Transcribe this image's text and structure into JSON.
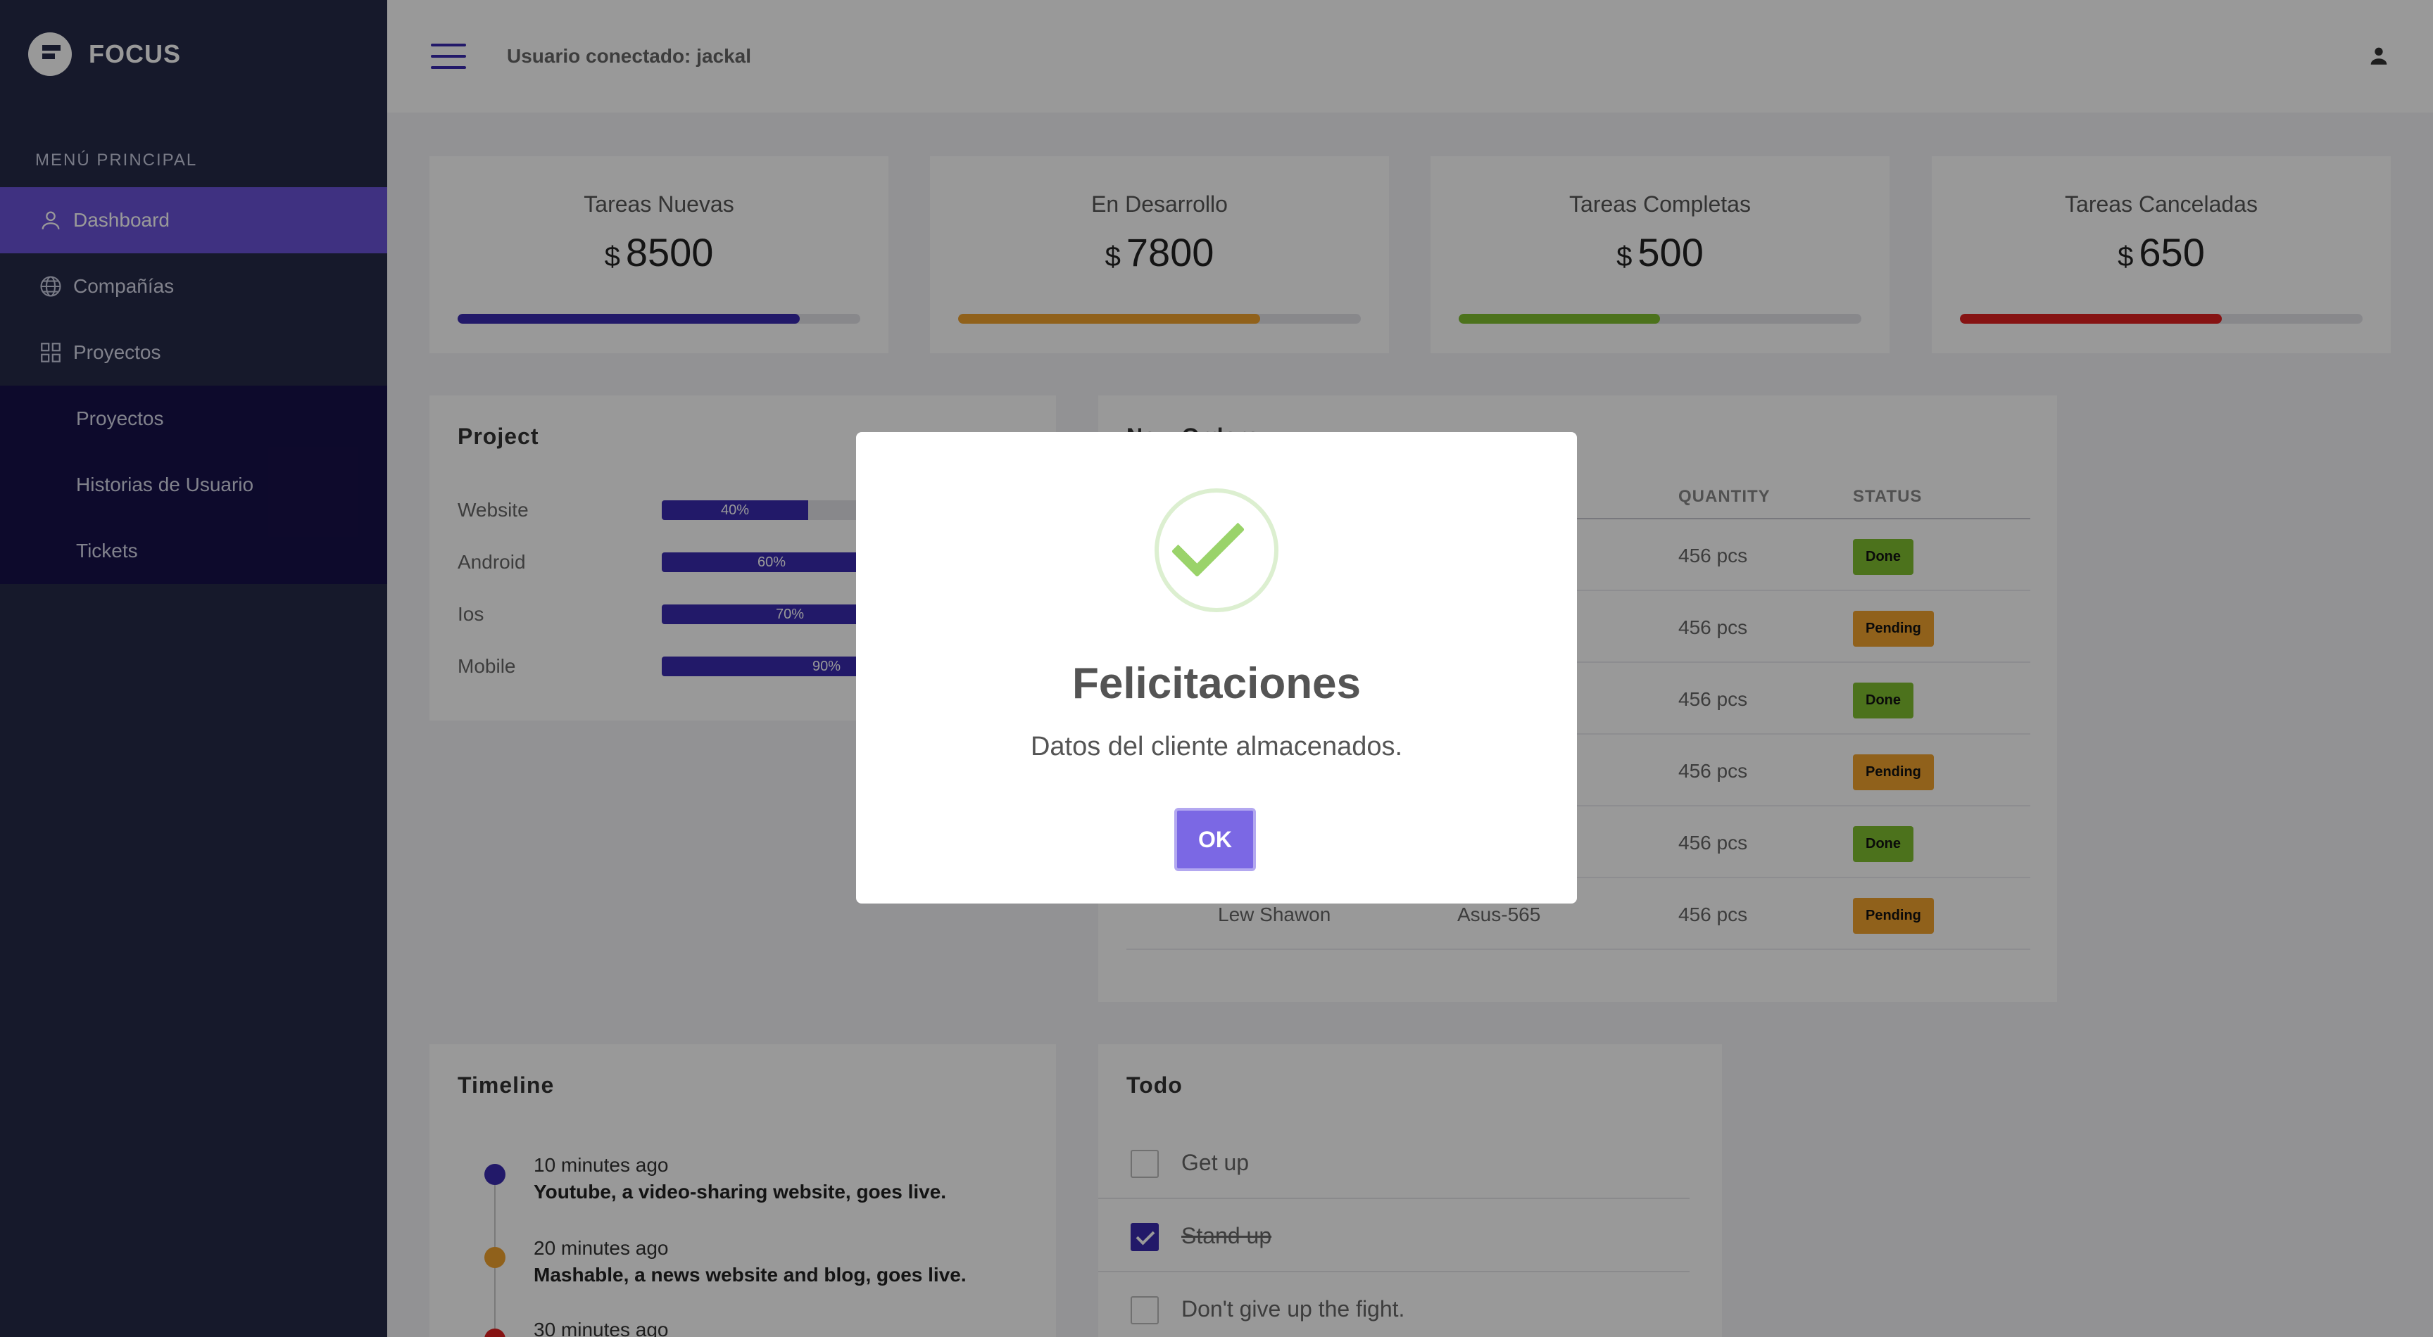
{
  "brand": {
    "name": "FOCUS"
  },
  "sidebar": {
    "menu_title": "MENÚ PRINCIPAL",
    "items": [
      {
        "label": "Dashboard",
        "icon": "user-icon",
        "active": true
      },
      {
        "label": "Compañías",
        "icon": "globe-icon"
      },
      {
        "label": "Proyectos",
        "icon": "grid-icon"
      }
    ],
    "subitems": [
      {
        "label": "Proyectos"
      },
      {
        "label": "Historias de Usuario"
      },
      {
        "label": "Tickets"
      }
    ]
  },
  "topbar": {
    "user_text": "Usuario conectado: jackal",
    "menu_icon": "hamburger-icon",
    "profile_icon": "person-icon"
  },
  "stats": [
    {
      "label": "Tareas Nuevas",
      "currency": "$",
      "value": "8500",
      "progress": 0.85,
      "color": "#3a2bb0"
    },
    {
      "label": "En Desarrollo",
      "currency": "$",
      "value": "7800",
      "progress": 0.75,
      "color": "#f0a22e"
    },
    {
      "label": "Tareas Completas",
      "currency": "$",
      "value": "500",
      "progress": 0.5,
      "color": "#7fbf2f"
    },
    {
      "label": "Tareas Canceladas",
      "currency": "$",
      "value": "650",
      "progress": 0.65,
      "color": "#e02020"
    }
  ],
  "project": {
    "title": "Project",
    "rows": [
      {
        "label": "Website",
        "percent": "40%",
        "value": 0.4
      },
      {
        "label": "Android",
        "percent": "60%",
        "value": 0.6
      },
      {
        "label": "Ios",
        "percent": "70%",
        "value": 0.7
      },
      {
        "label": "Mobile",
        "percent": "90%",
        "value": 0.9
      }
    ]
  },
  "orders": {
    "title": "New Orders",
    "headers": {
      "quantity": "QUANTITY",
      "status": "STATUS"
    },
    "rows": [
      {
        "name": "",
        "product": "",
        "quantity": "456 pcs",
        "status": "Done"
      },
      {
        "name": "",
        "product": "",
        "quantity": "456 pcs",
        "status": "Pending"
      },
      {
        "name": "",
        "product": "",
        "quantity": "456 pcs",
        "status": "Done"
      },
      {
        "name": "",
        "product": "",
        "quantity": "456 pcs",
        "status": "Pending"
      },
      {
        "name": "",
        "product": "",
        "quantity": "456 pcs",
        "status": "Done"
      },
      {
        "name": "Lew Shawon",
        "product": "Asus-565",
        "quantity": "456 pcs",
        "status": "Pending"
      }
    ]
  },
  "timeline": {
    "title": "Timeline",
    "items": [
      {
        "time": "10 minutes ago",
        "desc": "Youtube, a video-sharing website, goes live.",
        "color": "#3a2bb0"
      },
      {
        "time": "20 minutes ago",
        "desc": "Mashable, a news website and blog, goes live.",
        "color": "#f0a22e"
      },
      {
        "time": "30 minutes ago",
        "desc": "",
        "color": "#e02020"
      }
    ]
  },
  "todo": {
    "title": "Todo",
    "items": [
      {
        "text": "Get up",
        "checked": false
      },
      {
        "text": "Stand up",
        "checked": true
      },
      {
        "text": "Don't give up the fight.",
        "checked": false
      }
    ]
  },
  "modal": {
    "icon": "success-check-icon",
    "title": "Felicitaciones",
    "message": "Datos del cliente almacenados.",
    "ok_label": "OK"
  }
}
